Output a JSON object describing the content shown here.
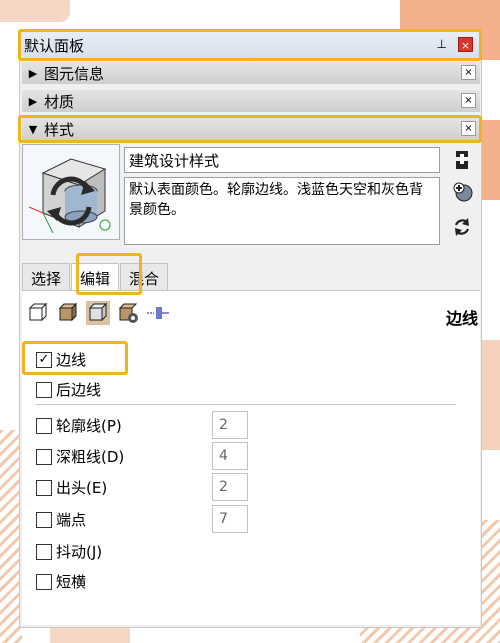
{
  "panel": {
    "title": "默认面板",
    "pin_glyph": "⊥",
    "close_glyph": "×"
  },
  "sections": [
    {
      "label": "图元信息",
      "arrow": "▶",
      "close": "×"
    },
    {
      "label": "材质",
      "arrow": "▶",
      "close": "×"
    },
    {
      "label": "样式",
      "arrow": "▼",
      "close": "×"
    }
  ],
  "style": {
    "name": "建筑设计样式",
    "description": "默认表面颜色。轮廓边线。浅蓝色天空和灰色背景颜色。"
  },
  "tabs": [
    {
      "label": "选择"
    },
    {
      "label": "编辑"
    },
    {
      "label": "混合"
    }
  ],
  "toolbar": {
    "icons": [
      "edge-settings-icon",
      "face-settings-icon",
      "background-settings-icon",
      "watermark-settings-icon",
      "modeling-settings-icon"
    ],
    "section_label": "边线"
  },
  "edges": {
    "edges": {
      "label": "边线",
      "checked": true
    },
    "back_edges": {
      "label": "后边线",
      "checked": false
    },
    "profiles": {
      "label": "轮廓线(P)",
      "checked": false,
      "value": "2"
    },
    "depth_cue": {
      "label": "深粗线(D)",
      "checked": false,
      "value": "4"
    },
    "extension": {
      "label": "出头(E)",
      "checked": false,
      "value": "2"
    },
    "endpoints": {
      "label": "端点",
      "checked": false,
      "value": "7"
    },
    "jitter": {
      "label": "抖动(J)",
      "checked": false
    },
    "halo": {
      "label": "短横",
      "checked": false
    }
  },
  "colors": {
    "highlight": "#f2b323",
    "close_red": "#d9362b"
  }
}
